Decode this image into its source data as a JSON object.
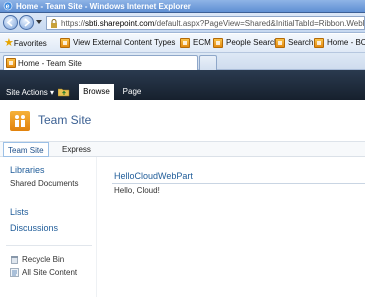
{
  "window": {
    "title": "Home - Team Site - Windows Internet Explorer"
  },
  "address": {
    "url_prefix": "https://",
    "url_host": "sbti.sharepoint.com",
    "url_path": "/default.aspx?PageView=Shared&InitialTabId=Ribbon.WebPartPage"
  },
  "favorites": {
    "label": "Favorites",
    "items": [
      {
        "label": "View External Content Types"
      },
      {
        "label": "ECM"
      },
      {
        "label": "People Search"
      },
      {
        "label": "Search"
      },
      {
        "label": "Home - BCS"
      }
    ]
  },
  "tabs": [
    {
      "label": "Home - Team Site"
    }
  ],
  "ribbon": {
    "site_actions": "Site Actions ▾",
    "tabs": [
      {
        "label": "Browse"
      },
      {
        "label": "Page"
      }
    ]
  },
  "site": {
    "title": "Team Site"
  },
  "topnav": [
    {
      "label": "Team Site"
    },
    {
      "label": "Express"
    }
  ],
  "quicklaunch": {
    "libraries": "Libraries",
    "shared_documents": "Shared Documents",
    "lists": "Lists",
    "discussions": "Discussions",
    "recycle_bin": "Recycle Bin",
    "all_site_content": "All Site Content"
  },
  "webpart": {
    "title": "HelloCloudWebPart",
    "body": "Hello, Cloud!"
  },
  "colors": {
    "accent": "#1f5c99",
    "ribbon": "#1e2b3b",
    "logo": "#f0a030"
  },
  "icons": [
    "ie-icon",
    "back-icon",
    "forward-icon",
    "lock-icon",
    "star-icon",
    "sharepoint-page-icon",
    "folder-up-icon",
    "site-logo-icon",
    "recycle-bin-icon",
    "all-site-content-icon"
  ]
}
